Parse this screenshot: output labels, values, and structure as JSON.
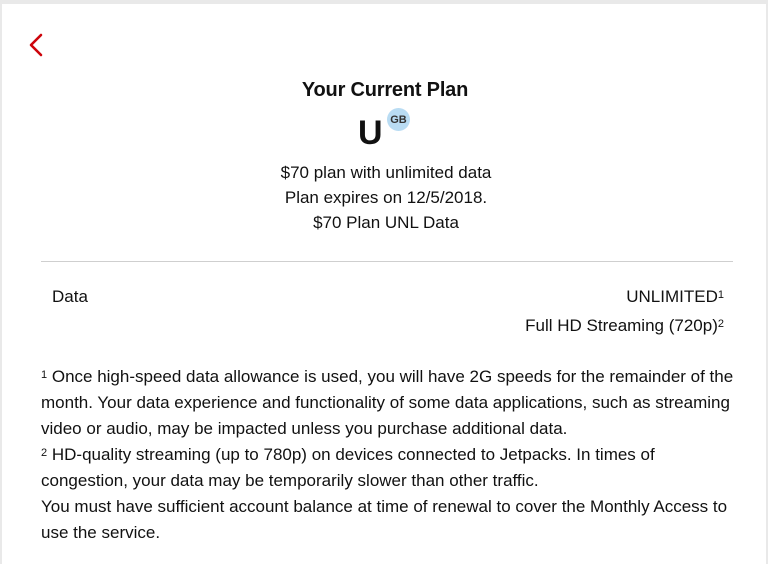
{
  "header": {
    "back_icon": "chevron-left-icon",
    "accent": "#cd040b"
  },
  "plan": {
    "title": "Your Current Plan",
    "letter": "U",
    "badge": "GB",
    "description": "$70 plan with unlimited data",
    "expires": "Plan expires on 12/5/2018.",
    "name": "$70 Plan UNL Data"
  },
  "data_row": {
    "label": "Data",
    "value": "UNLIMITED",
    "value_sup": "1",
    "streaming": "Full HD Streaming (720p)",
    "streaming_sup": "2"
  },
  "footnotes": {
    "n1_sup": "1",
    "n1_text": " Once high-speed data allowance is used, you will have 2G speeds for the remainder of the month. Your data experience and functionality of some data applications, such as streaming video or audio, may be impacted unless you purchase additional data.",
    "n2_sup": "2",
    "n2_text": " HD-quality streaming (up to 780p) on devices connected to Jetpacks. In times of congestion, your data may be temporarily slower than other traffic.",
    "balance_note": "You must have sufficient account balance at time of renewal to cover the Monthly Access to use the service."
  }
}
